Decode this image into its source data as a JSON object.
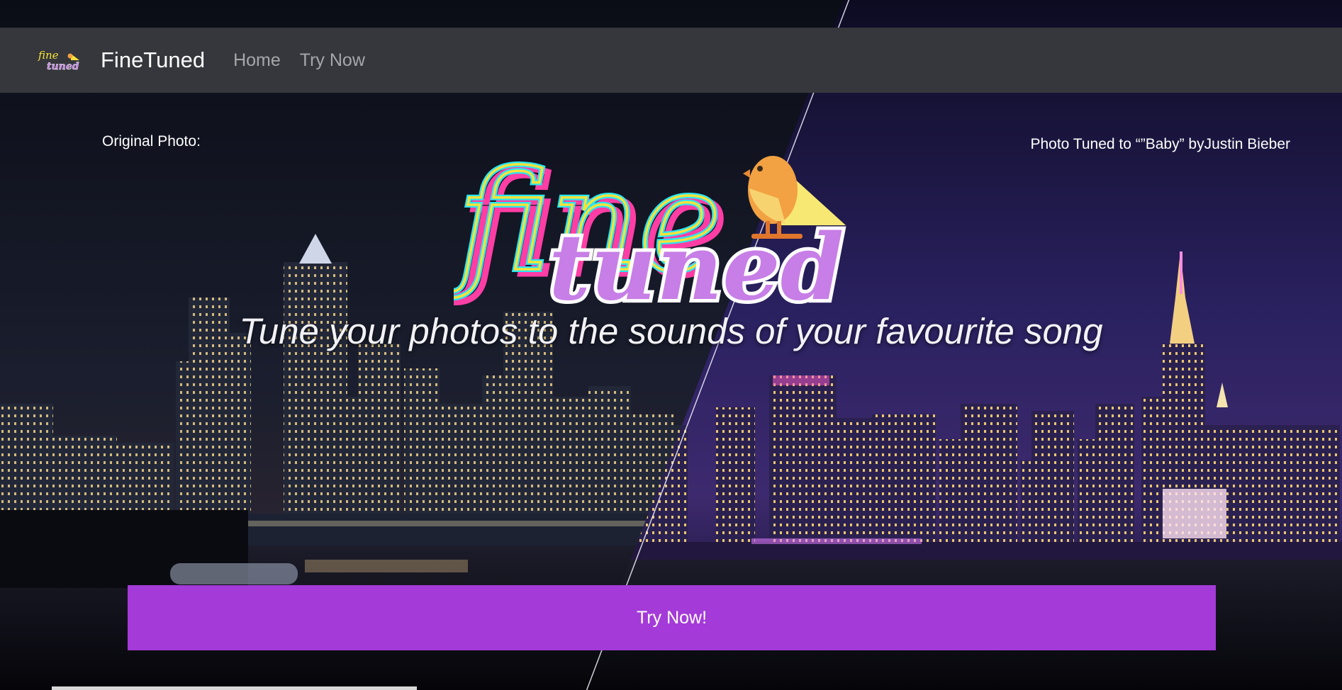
{
  "navbar": {
    "brand": "FineTuned",
    "links": [
      "Home",
      "Try Now"
    ],
    "logo_text_top": "fine",
    "logo_text_bottom": "tuned"
  },
  "hero": {
    "caption_left": "Original Photo:",
    "caption_right": "Photo Tuned to “”Baby” byJustin Bieber",
    "logo_word_1": "fine",
    "logo_word_2": "tuned",
    "logo_icon": "bird-icon",
    "tagline": "Tune your photos to the sounds of your favourite song",
    "cta_label": "Try Now!"
  },
  "colors": {
    "navbar_bg": "#35373c",
    "cta_bg": "#a43ad8",
    "logo_purple": "#c77ee6",
    "logo_cyan": "#29e6f2",
    "logo_yellow": "#f6e23a",
    "logo_pink": "#ff3ea5",
    "bird_orange": "#f2a143"
  }
}
